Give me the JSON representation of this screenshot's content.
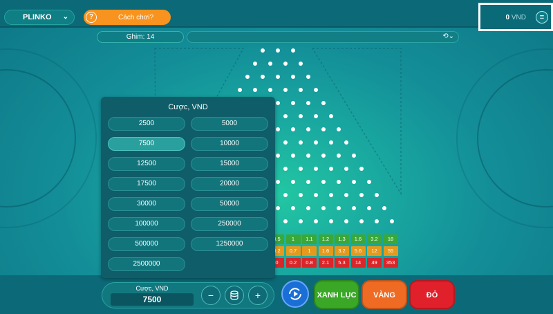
{
  "header": {
    "game_name": "PLINKO",
    "how_to_play": "Cách chơi?",
    "balance_amount": "0",
    "balance_currency": "VND"
  },
  "pins_label": "Ghim: 14",
  "board": {
    "multiplier_rows": [
      {
        "color": "#3aa836",
        "values": [
          "0.5",
          "1",
          "1.1",
          "1.2",
          "1.3",
          "1.6",
          "3.2",
          "18"
        ]
      },
      {
        "color": "#e49a1c",
        "values": [
          "0.2",
          "0.7",
          "1",
          "1.6",
          "3.2",
          "5.6",
          "12",
          "55"
        ]
      },
      {
        "color": "#d8262a",
        "values": [
          "0",
          "0.2",
          "0.8",
          "2.1",
          "5.3",
          "14",
          "49",
          "353"
        ]
      }
    ]
  },
  "bet_panel": {
    "title": "Cược, VND",
    "options": [
      "2500",
      "5000",
      "7500",
      "10000",
      "12500",
      "15000",
      "17500",
      "20000",
      "30000",
      "50000",
      "100000",
      "250000",
      "500000",
      "1250000",
      "2500000"
    ],
    "selected": "7500"
  },
  "bet_control": {
    "label": "Cược, VND",
    "value": "7500",
    "minus": "−",
    "plus": "+"
  },
  "buttons": [
    {
      "label": "XANH LỤC",
      "color": "#3aa826"
    },
    {
      "label": "VÀNG",
      "color": "#ef6a22"
    },
    {
      "label": "ĐỎ",
      "color": "#e0202a"
    }
  ]
}
